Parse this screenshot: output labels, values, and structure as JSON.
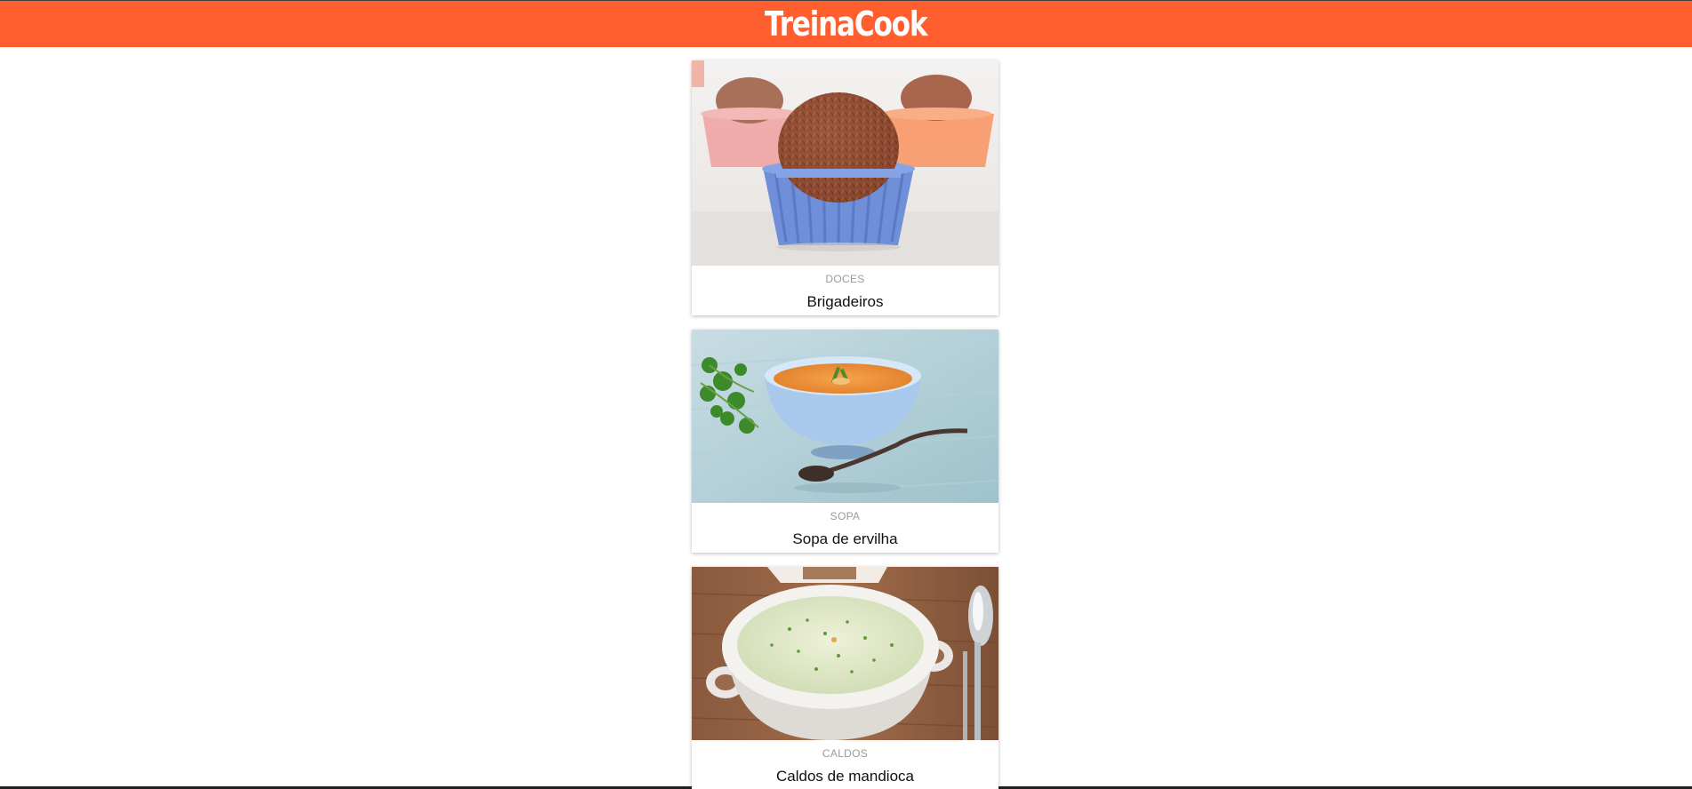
{
  "header": {
    "logo_text": "TreinaCook",
    "background_color": "#ff5e2f"
  },
  "recipes": [
    {
      "category": "DOCES",
      "title": "Brigadeiros",
      "image": "brigadeiro-photo"
    },
    {
      "category": "SOPA",
      "title": "Sopa de ervilha",
      "image": "pea-soup-photo"
    },
    {
      "category": "CALDOS",
      "title": "Caldos de mandioca",
      "image": "cassava-broth-photo"
    }
  ]
}
